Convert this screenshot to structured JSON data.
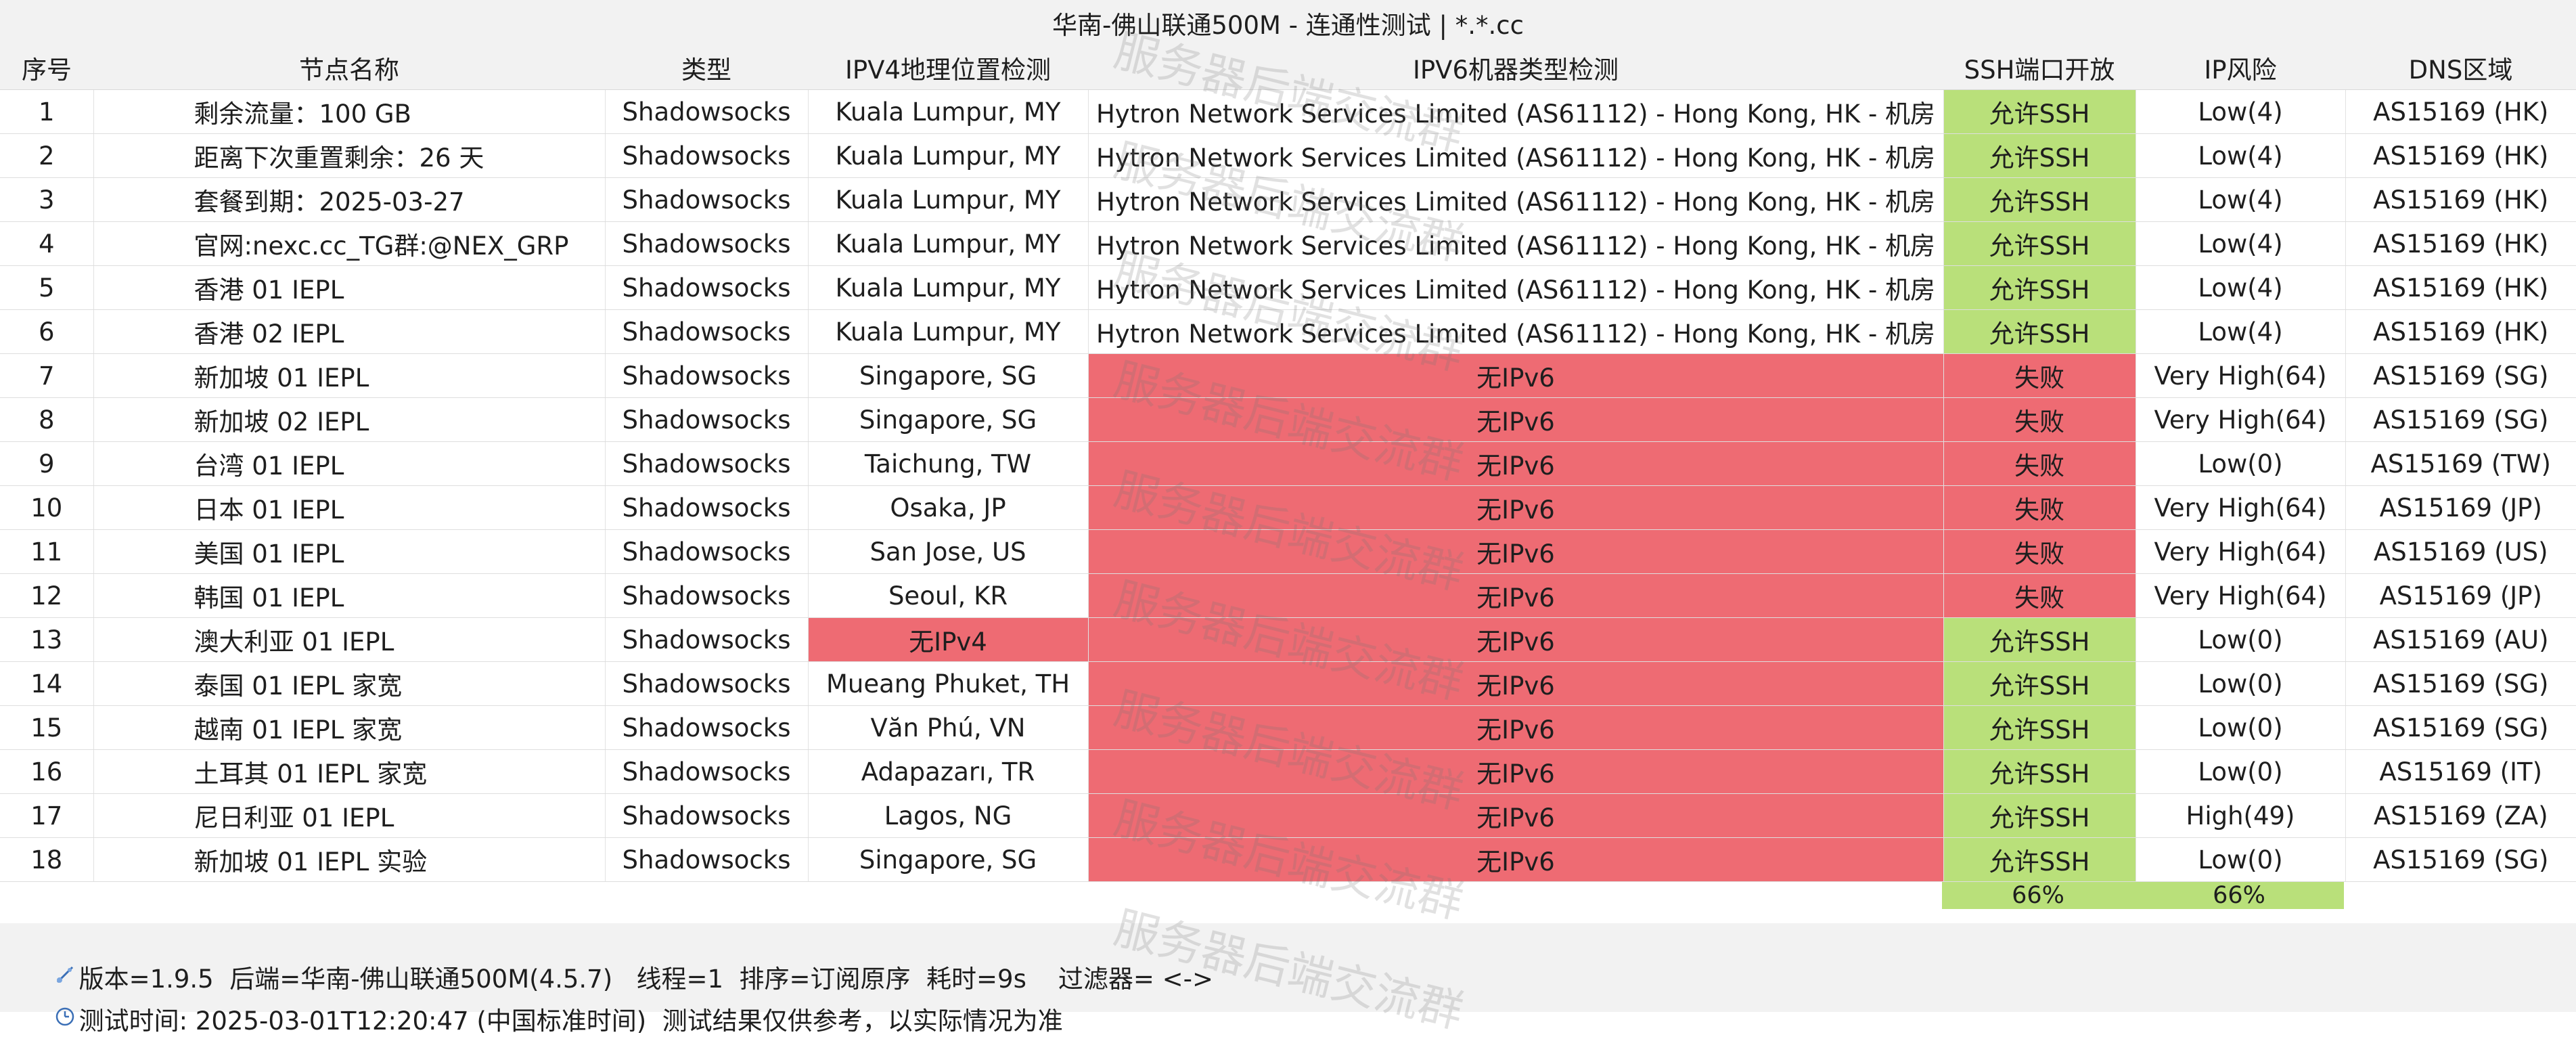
{
  "title": "华南-佛山联通500M - 连通性测试 | *.*.cc",
  "columns": [
    "序号",
    "节点名称",
    "类型",
    "IPV4地理位置检测",
    "IPV6机器类型检测",
    "SSH端口开放",
    "IP风险",
    "DNS区域"
  ],
  "rows": [
    {
      "no": "1",
      "name": "剩余流量：100 GB",
      "type": "Shadowsocks",
      "ipv4": "Kuala Lumpur, MY",
      "ipv6": "Hytron Network Services Limited (AS61112) - Hong Kong, HK - 机房",
      "ssh": "允许SSH",
      "risk": "Low(4)",
      "dns": "AS15169 (HK)"
    },
    {
      "no": "2",
      "name": "距离下次重置剩余：26 天",
      "type": "Shadowsocks",
      "ipv4": "Kuala Lumpur, MY",
      "ipv6": "Hytron Network Services Limited (AS61112) - Hong Kong, HK - 机房",
      "ssh": "允许SSH",
      "risk": "Low(4)",
      "dns": "AS15169 (HK)"
    },
    {
      "no": "3",
      "name": "套餐到期：2025-03-27",
      "type": "Shadowsocks",
      "ipv4": "Kuala Lumpur, MY",
      "ipv6": "Hytron Network Services Limited (AS61112) - Hong Kong, HK - 机房",
      "ssh": "允许SSH",
      "risk": "Low(4)",
      "dns": "AS15169 (HK)"
    },
    {
      "no": "4",
      "name": "官网:nexc.cc_TG群:@NEX_GRP",
      "type": "Shadowsocks",
      "ipv4": "Kuala Lumpur, MY",
      "ipv6": "Hytron Network Services Limited (AS61112) - Hong Kong, HK - 机房",
      "ssh": "允许SSH",
      "risk": "Low(4)",
      "dns": "AS15169 (HK)"
    },
    {
      "no": "5",
      "name": "香港 01 IEPL",
      "type": "Shadowsocks",
      "ipv4": "Kuala Lumpur, MY",
      "ipv6": "Hytron Network Services Limited (AS61112) - Hong Kong, HK - 机房",
      "ssh": "允许SSH",
      "risk": "Low(4)",
      "dns": "AS15169 (HK)"
    },
    {
      "no": "6",
      "name": "香港 02 IEPL",
      "type": "Shadowsocks",
      "ipv4": "Kuala Lumpur, MY",
      "ipv6": "Hytron Network Services Limited (AS61112) - Hong Kong, HK - 机房",
      "ssh": "允许SSH",
      "risk": "Low(4)",
      "dns": "AS15169 (HK)"
    },
    {
      "no": "7",
      "name": "新加坡 01 IEPL",
      "type": "Shadowsocks",
      "ipv4": "Singapore, SG",
      "ipv6": "无IPv6",
      "ssh": "失败",
      "risk": "Very High(64)",
      "dns": "AS15169 (SG)"
    },
    {
      "no": "8",
      "name": "新加坡 02 IEPL",
      "type": "Shadowsocks",
      "ipv4": "Singapore, SG",
      "ipv6": "无IPv6",
      "ssh": "失败",
      "risk": "Very High(64)",
      "dns": "AS15169 (SG)"
    },
    {
      "no": "9",
      "name": "台湾 01 IEPL",
      "type": "Shadowsocks",
      "ipv4": "Taichung, TW",
      "ipv6": "无IPv6",
      "ssh": "失败",
      "risk": "Low(0)",
      "dns": "AS15169 (TW)"
    },
    {
      "no": "10",
      "name": "日本 01 IEPL",
      "type": "Shadowsocks",
      "ipv4": "Osaka, JP",
      "ipv6": "无IPv6",
      "ssh": "失败",
      "risk": "Very High(64)",
      "dns": "AS15169 (JP)"
    },
    {
      "no": "11",
      "name": "美国 01 IEPL",
      "type": "Shadowsocks",
      "ipv4": "San Jose, US",
      "ipv6": "无IPv6",
      "ssh": "失败",
      "risk": "Very High(64)",
      "dns": "AS15169 (US)"
    },
    {
      "no": "12",
      "name": "韩国 01 IEPL",
      "type": "Shadowsocks",
      "ipv4": "Seoul, KR",
      "ipv6": "无IPv6",
      "ssh": "失败",
      "risk": "Very High(64)",
      "dns": "AS15169 (JP)"
    },
    {
      "no": "13",
      "name": "澳大利亚 01 IEPL",
      "type": "Shadowsocks",
      "ipv4": "无IPv4",
      "ipv6": "无IPv6",
      "ssh": "允许SSH",
      "risk": "Low(0)",
      "dns": "AS15169 (AU)"
    },
    {
      "no": "14",
      "name": "泰国 01 IEPL 家宽",
      "type": "Shadowsocks",
      "ipv4": "Mueang Phuket, TH",
      "ipv6": "无IPv6",
      "ssh": "允许SSH",
      "risk": "Low(0)",
      "dns": "AS15169 (SG)"
    },
    {
      "no": "15",
      "name": "越南 01 IEPL 家宽",
      "type": "Shadowsocks",
      "ipv4": "Văn Phú, VN",
      "ipv6": "无IPv6",
      "ssh": "允许SSH",
      "risk": "Low(0)",
      "dns": "AS15169 (SG)"
    },
    {
      "no": "16",
      "name": "土耳其 01 IEPL 家宽",
      "type": "Shadowsocks",
      "ipv4": "Adapazarı, TR",
      "ipv6": "无IPv6",
      "ssh": "允许SSH",
      "risk": "Low(0)",
      "dns": "AS15169 (IT)"
    },
    {
      "no": "17",
      "name": "尼日利亚 01 IEPL",
      "type": "Shadowsocks",
      "ipv4": "Lagos, NG",
      "ipv6": "无IPv6",
      "ssh": "允许SSH",
      "risk": "High(49)",
      "dns": "AS15169 (ZA)"
    },
    {
      "no": "18",
      "name": "新加坡 01 IEPL 实验",
      "type": "Shadowsocks",
      "ipv4": "Singapore, SG",
      "ipv6": "无IPv6",
      "ssh": "允许SSH",
      "risk": "Low(0)",
      "dns": "AS15169 (SG)"
    }
  ],
  "summary": {
    "ssh_pct": "66%",
    "risk_pct": "66%"
  },
  "footer": {
    "line1": "版本=1.9.5  后端=华南-佛山联通500M(4.5.7)   线程=1  排序=订阅原序  耗时=9s    过滤器= <->",
    "line2": "测试时间: 2025-03-01T12:20:47 (中国标准时间)  测试结果仅供参考，以实际情况为准"
  },
  "watermark": "服务器后端交流群",
  "colors": {
    "ok": "#b9e07a",
    "bad": "#ee6b73",
    "header_bg": "#f2f2f2"
  },
  "icons": {
    "footer_line1": "satellite-icon",
    "footer_line2": "clock-icon"
  }
}
